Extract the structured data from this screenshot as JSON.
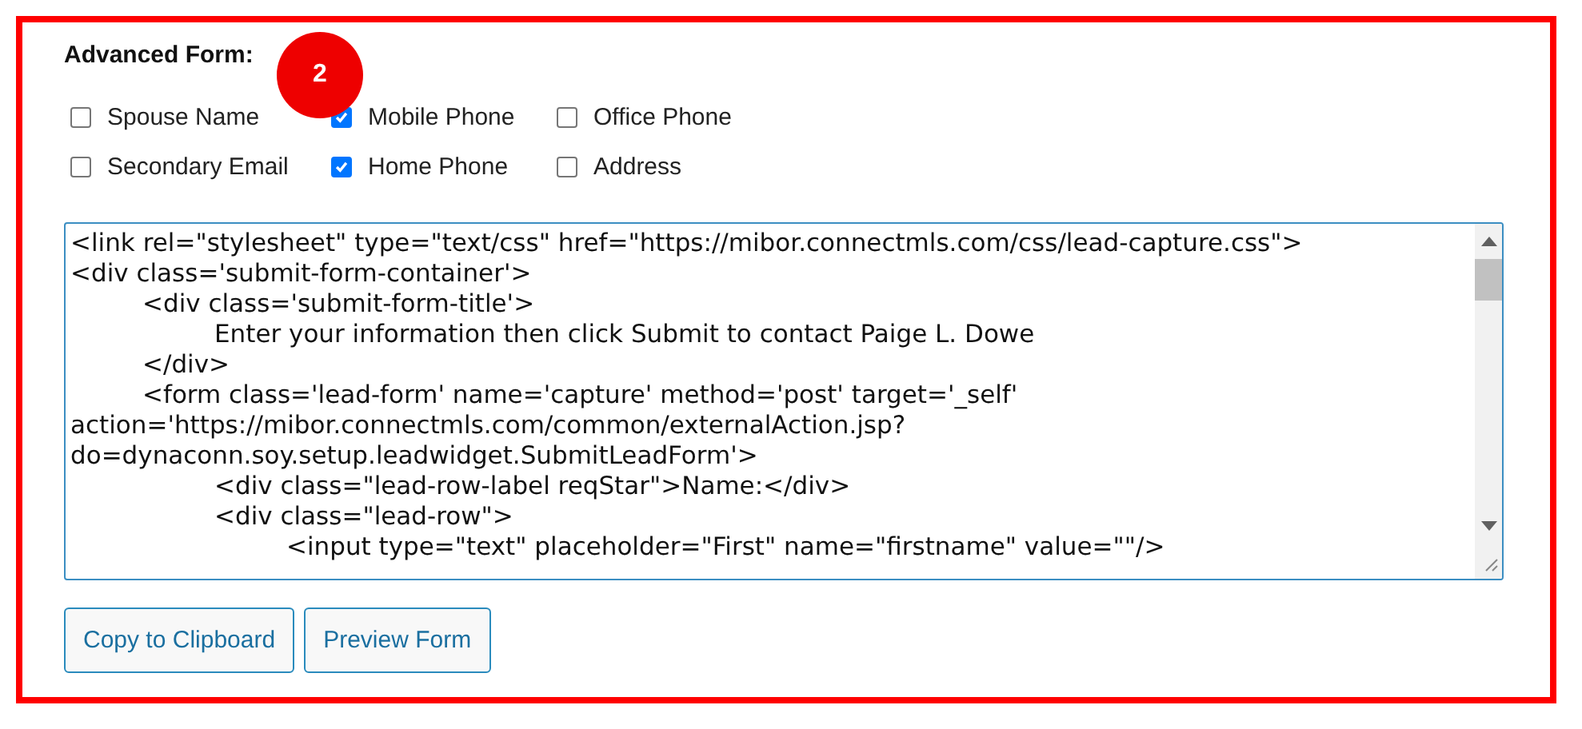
{
  "title": "Advanced Form:",
  "badge": "2",
  "options": [
    {
      "label": "Spouse Name",
      "checked": false
    },
    {
      "label": "Mobile Phone",
      "checked": true
    },
    {
      "label": "Office Phone",
      "checked": false
    },
    {
      "label": "Secondary Email",
      "checked": false
    },
    {
      "label": "Home Phone",
      "checked": true
    },
    {
      "label": "Address",
      "checked": false
    }
  ],
  "code_lines": [
    "<link rel=\"stylesheet\" type=\"text/css\" href=\"https://mibor.connectmls.com/css/lead-capture.css\">",
    "<div class='submit-form-container'>",
    "\t<div class='submit-form-title'>",
    "\t\tEnter your information then click Submit to contact Paige L. Dowe",
    "\t</div>",
    "\t<form class='lead-form' name='capture' method='post' target='_self'",
    "action='https://mibor.connectmls.com/common/externalAction.jsp?",
    "do=dynaconn.soy.setup.leadwidget.SubmitLeadForm'>",
    "\t\t<div class=\"lead-row-label reqStar\">Name:</div>",
    "\t\t<div class=\"lead-row\">",
    "\t\t\t<input type=\"text\" placeholder=\"First\" name=\"firstname\" value=\"\"/>"
  ],
  "buttons": [
    "Copy to Clipboard",
    "Preview Form"
  ]
}
